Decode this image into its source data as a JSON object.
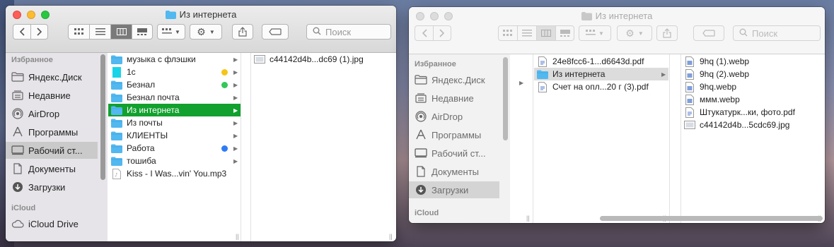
{
  "left_window": {
    "title": "Из интернета",
    "search_placeholder": "Поиск",
    "sidebar": {
      "favorites_header": "Избранное",
      "icloud_header": "iCloud",
      "items": [
        {
          "label": "Яндекс.Диск",
          "icon": "folder-outline-icon"
        },
        {
          "label": "Недавние",
          "icon": "clock-stack-icon"
        },
        {
          "label": "AirDrop",
          "icon": "airdrop-icon"
        },
        {
          "label": "Программы",
          "icon": "applications-icon"
        },
        {
          "label": "Рабочий ст...",
          "icon": "desktop-icon",
          "selected": true
        },
        {
          "label": "Документы",
          "icon": "document-icon"
        },
        {
          "label": "Загрузки",
          "icon": "downloads-icon"
        }
      ],
      "icloud_items": [
        {
          "label": "iCloud Drive",
          "icon": "cloud-icon"
        }
      ]
    },
    "column1": [
      {
        "name": "музыка с флэшки",
        "type": "folder",
        "arrow": true
      },
      {
        "name": "1с",
        "type": "file-cyan",
        "tag": "#f5c518",
        "arrow": true
      },
      {
        "name": "Безнал",
        "type": "folder",
        "tag": "#34c759",
        "arrow": true
      },
      {
        "name": "Безнал почта",
        "type": "folder",
        "arrow": true
      },
      {
        "name": "Из интернета",
        "type": "folder",
        "arrow": true,
        "selected": true
      },
      {
        "name": "Из почты",
        "type": "folder",
        "arrow": true
      },
      {
        "name": "КЛИЕНТЫ",
        "type": "folder",
        "arrow": true
      },
      {
        "name": "Работа",
        "type": "folder",
        "tag": "#2f7bf5",
        "arrow": true
      },
      {
        "name": "тошиба",
        "type": "folder",
        "arrow": true
      },
      {
        "name": "Kiss - I Was...vin' You.mp3",
        "type": "audio"
      }
    ],
    "column2": [
      {
        "name": "c44142d4b...dc69 (1).jpg",
        "type": "image"
      }
    ]
  },
  "right_window": {
    "title": "Из интернета",
    "search_placeholder": "Поиск",
    "sidebar": {
      "favorites_header": "Избранное",
      "icloud_header": "iCloud",
      "items": [
        {
          "label": "Яндекс.Диск",
          "icon": "folder-outline-icon"
        },
        {
          "label": "Недавние",
          "icon": "clock-stack-icon"
        },
        {
          "label": "AirDrop",
          "icon": "airdrop-icon"
        },
        {
          "label": "Программы",
          "icon": "applications-icon"
        },
        {
          "label": "Рабочий ст...",
          "icon": "desktop-icon"
        },
        {
          "label": "Документы",
          "icon": "document-icon"
        },
        {
          "label": "Загрузки",
          "icon": "downloads-icon",
          "selected": true
        }
      ],
      "icloud_items": [
        {
          "label": "iCloud Drive",
          "icon": "cloud-icon"
        }
      ]
    },
    "column1": [
      {
        "name": "24e8fcc6-1...d6643d.pdf",
        "type": "pdf"
      },
      {
        "name": "Из интернета",
        "type": "folder",
        "arrow": true,
        "selected": true
      },
      {
        "name": "Счет на опл...20 г (3).pdf",
        "type": "pdf"
      }
    ],
    "column2": [
      {
        "name": "9hq (1).webp",
        "type": "webp"
      },
      {
        "name": "9hq (2).webp",
        "type": "webp"
      },
      {
        "name": "9hq.webp",
        "type": "webp"
      },
      {
        "name": "ммм.webp",
        "type": "webp"
      },
      {
        "name": "Штукатурк...ки, фото.pdf",
        "type": "pdf"
      },
      {
        "name": "c44142d4b...5cdc69.jpg",
        "type": "image"
      }
    ]
  },
  "colors": {
    "selection_green": "#12a02e",
    "folder_blue": "#52b8f0"
  }
}
